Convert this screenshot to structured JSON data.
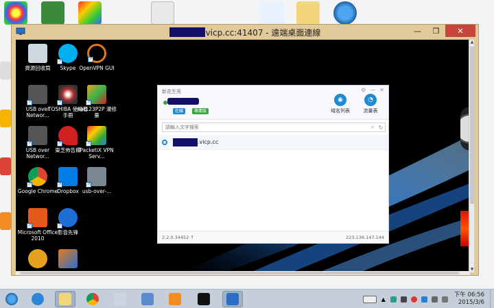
{
  "window": {
    "title": "vicp.cc:41407 - 遠端桌面連線",
    "controls": {
      "minimize": "—",
      "restore": "❐",
      "close": "✕"
    }
  },
  "remote_desktop_icons": [
    {
      "label": "資源回收筒",
      "icon": "recycle-bin-icon",
      "color": "#cfd8e0"
    },
    {
      "label": "Skype",
      "icon": "skype-icon",
      "color": "#00aff0"
    },
    {
      "label": "OpenVPN GUI",
      "icon": "openvpn-icon",
      "color": "#e07a1a"
    },
    {
      "label": "USB over Networ...",
      "icon": "usb-network-icon",
      "color": "#555555"
    },
    {
      "label": "TOSHIBA 使用者手冊",
      "icon": "toshiba-manual-icon",
      "color": "#b03030"
    },
    {
      "label": "nat123P2P 灌修量",
      "icon": "nat123-icon",
      "color": "#e8a020"
    },
    {
      "label": "USB over Networ...",
      "icon": "usb-network-icon",
      "color": "#555555"
    },
    {
      "label": "東芝佈告欄",
      "icon": "toshiba-board-icon",
      "color": "#d02020"
    },
    {
      "label": "PacketiX VPN Serv...",
      "icon": "packetix-icon",
      "color": "#2a7fd0"
    },
    {
      "label": "Google Chrome",
      "icon": "chrome-icon",
      "color": "#db4437"
    },
    {
      "label": "Dropbox",
      "icon": "dropbox-icon",
      "color": "#007ee5"
    },
    {
      "label": "usb-over-...",
      "icon": "usb-over-icon",
      "color": "#7a8894"
    },
    {
      "label": "Microsoft Office 2010",
      "icon": "office-icon",
      "color": "#e55a1a"
    },
    {
      "label": "影音先锋",
      "icon": "media-player-icon",
      "color": "#1d6fd3"
    },
    {
      "label": "",
      "icon": "globe-icon",
      "color": "#e6a21c"
    },
    {
      "label": "",
      "icon": "cube-icon",
      "color": "#e57a1a"
    }
  ],
  "client_app": {
    "title": "新花生壳",
    "status_online": "在線",
    "status_level": "專業版",
    "buttons": {
      "domain_list": "域名列表",
      "traffic": "流量表"
    },
    "search_placeholder": "請輸入文字搜索",
    "domain_row_text": ".vicp.cc",
    "version": "2.2.0.34452",
    "ip": "223.136.147.144"
  },
  "taskbar": {
    "time": "下午 06:56",
    "date": "2015/3/6"
  },
  "colors": {
    "rdp_frame": "#e2c99a",
    "close_button": "#c7453a",
    "redaction": "#14106a",
    "accent_blue": "#1f8ad1"
  }
}
